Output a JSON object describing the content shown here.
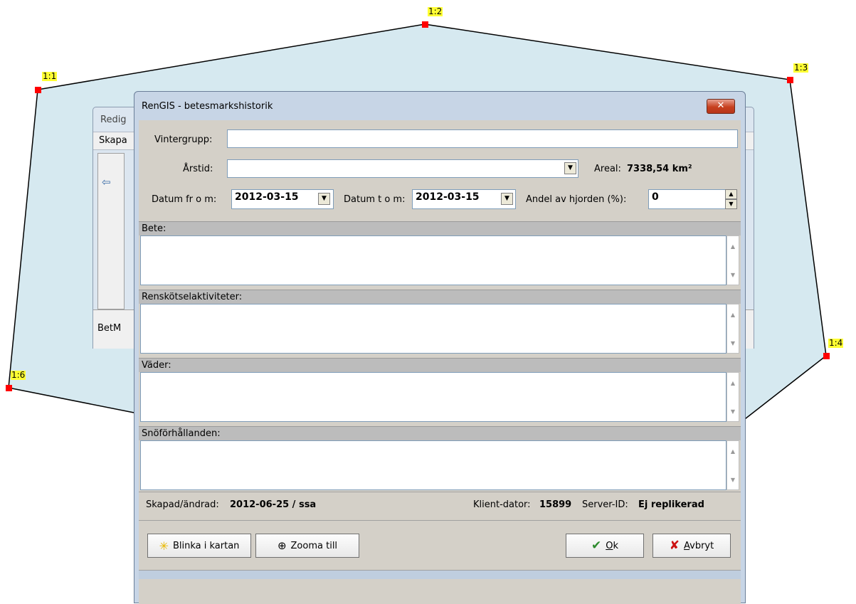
{
  "map": {
    "fill": "#d6e9f0",
    "vertices": [
      {
        "label": "1:1"
      },
      {
        "label": "1:2"
      },
      {
        "label": "1:3"
      },
      {
        "label": "1:4"
      },
      {
        "label": "1:6"
      }
    ]
  },
  "background_window": {
    "title": "Redig",
    "menu": "Skapa",
    "bottom_text": "BetM"
  },
  "dialog": {
    "title": "RenGIS - betesmarkshistorik",
    "close_icon": "close-x-icon",
    "vintergrupp": {
      "label": "Vintergrupp:",
      "value": ""
    },
    "arstid": {
      "label": "Årstid:",
      "value": ""
    },
    "areal": {
      "label": "Areal:",
      "value": "7338,54 km²"
    },
    "datum_from": {
      "label": "Datum fr o m:",
      "value": "2012-03-15"
    },
    "datum_tom": {
      "label": "Datum t o m:",
      "value": "2012-03-15"
    },
    "andel": {
      "label": "Andel av hjorden (%):",
      "value": "0"
    },
    "sections": {
      "bete": "Bete:",
      "rensk": "Renskötselaktiviteter:",
      "vader": "Väder:",
      "sno": "Snöförhållanden:"
    },
    "status": {
      "skapad_label": "Skapad/ändrad:",
      "skapad_value": "2012-06-25 / ssa",
      "klient_label": "Klient-dator:",
      "klient_value": "15899",
      "server_label": "Server-ID:",
      "server_value": "Ej replikerad"
    },
    "buttons": {
      "blinka": "Blinka i kartan",
      "zooma": "Zooma till",
      "ok_pre": "",
      "ok_u": "O",
      "ok_post": "k",
      "avbryt_u": "A",
      "avbryt_post": "vbryt"
    },
    "colors": {
      "ok_check": "#2e8b2e",
      "avbryt_x": "#cc1111"
    }
  }
}
